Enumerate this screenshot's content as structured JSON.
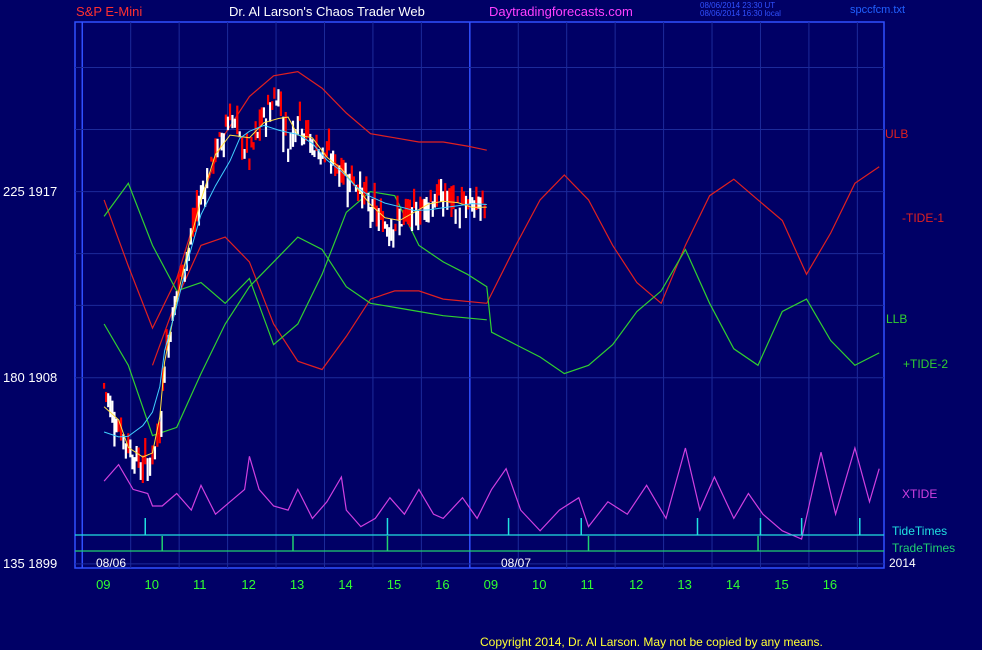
{
  "header": {
    "instrument": "S&P E-Mini",
    "site_title": "Dr. Al Larson's Chaos Trader Web",
    "site_url": "Daytradingforecasts.com",
    "timestamp_ut": "08/06/2014 23:30 UT",
    "timestamp_local": "08/06/2014 16:30 local",
    "chart_file": "spccfcm.txt"
  },
  "copyright": "Copyright 2014, Dr. Al Larson. May not be copied by any means.",
  "colors": {
    "background": "#000066",
    "price_up": "#ffffff",
    "price_down": "#ff0000",
    "ulb": "#e02020",
    "llb": "#30d030",
    "tide1": "#e02020",
    "tide2": "#30d030",
    "xtide": "#d040e0",
    "tidetimes": "#20e0e0",
    "tradetimes": "#20d070"
  },
  "chart_data": {
    "type": "line",
    "y_ticks": [
      {
        "label": "225  1917",
        "value": 1917
      },
      {
        "label": "180  1908",
        "value": 1908
      },
      {
        "label": "135  1899",
        "value": 1899
      }
    ],
    "x_ticks": [
      "09",
      "10",
      "11",
      "12",
      "13",
      "14",
      "15",
      "16",
      "09",
      "10",
      "11",
      "12",
      "13",
      "14",
      "15",
      "16"
    ],
    "date_labels": [
      "08/06",
      "08/07"
    ],
    "year_label": "2014",
    "right_labels": [
      {
        "key": "ulb",
        "text": "ULB"
      },
      {
        "key": "tide1",
        "text": "-TIDE-1"
      },
      {
        "key": "llb",
        "text": "LLB"
      },
      {
        "key": "tide2",
        "text": "+TIDE-2"
      },
      {
        "key": "xtide",
        "text": "XTIDE"
      },
      {
        "key": "tidetimes",
        "text": "TideTimes"
      },
      {
        "key": "tradetimes",
        "text": "TradeTimes"
      }
    ],
    "price_hourly_path": [
      [
        0.0,
        1907.6
      ],
      [
        0.3,
        1905.6
      ],
      [
        0.5,
        1904.7
      ],
      [
        0.8,
        1903.6
      ],
      [
        1.0,
        1904.2
      ],
      [
        1.15,
        1905.3
      ],
      [
        1.25,
        1908.8
      ],
      [
        1.5,
        1912.2
      ],
      [
        1.75,
        1914.2
      ],
      [
        2.0,
        1916.8
      ],
      [
        2.3,
        1918.8
      ],
      [
        2.6,
        1920.8
      ],
      [
        2.8,
        1919.6
      ],
      [
        3.0,
        1918.6
      ],
      [
        3.3,
        1920.6
      ],
      [
        3.6,
        1921.8
      ],
      [
        3.8,
        1919.2
      ],
      [
        4.0,
        1920.8
      ],
      [
        4.3,
        1919.2
      ],
      [
        4.6,
        1918.8
      ],
      [
        4.9,
        1918.0
      ],
      [
        5.2,
        1917.5
      ],
      [
        5.5,
        1916.2
      ],
      [
        5.8,
        1915.4
      ],
      [
        6.1,
        1915.6
      ],
      [
        6.4,
        1915.8
      ],
      [
        6.7,
        1916.6
      ],
      [
        7.0,
        1916.8
      ],
      [
        7.3,
        1916.2
      ],
      [
        7.6,
        1916.4
      ],
      [
        7.9,
        1916.1
      ]
    ],
    "series": [
      {
        "key": "ulb",
        "points": [
          [
            0.0,
            1916.6
          ],
          [
            0.5,
            1913.4
          ],
          [
            1.0,
            1910.4
          ],
          [
            1.5,
            1912.8
          ],
          [
            2.0,
            1916.6
          ],
          [
            2.5,
            1919.8
          ],
          [
            3.0,
            1921.6
          ],
          [
            3.5,
            1922.6
          ],
          [
            4.0,
            1922.8
          ],
          [
            4.5,
            1922.0
          ],
          [
            5.0,
            1920.8
          ],
          [
            5.5,
            1919.8
          ],
          [
            6.0,
            1919.6
          ],
          [
            6.5,
            1919.4
          ],
          [
            7.0,
            1919.4
          ],
          [
            7.5,
            1919.2
          ],
          [
            7.9,
            1919.0
          ]
        ]
      },
      {
        "key": "tide1",
        "points": [
          [
            1.0,
            1908.6
          ],
          [
            1.5,
            1911.8
          ],
          [
            2.0,
            1914.4
          ],
          [
            2.5,
            1914.8
          ],
          [
            3.0,
            1913.6
          ],
          [
            3.5,
            1910.6
          ],
          [
            4.0,
            1908.8
          ],
          [
            4.5,
            1908.4
          ],
          [
            5.0,
            1910.0
          ],
          [
            5.5,
            1911.8
          ],
          [
            6.0,
            1912.2
          ],
          [
            6.5,
            1912.2
          ],
          [
            7.0,
            1911.8
          ],
          [
            7.9,
            1911.6
          ],
          [
            8.5,
            1914.4
          ],
          [
            9.0,
            1916.6
          ],
          [
            9.5,
            1917.8
          ],
          [
            10.0,
            1916.6
          ],
          [
            10.5,
            1914.4
          ],
          [
            11.0,
            1912.6
          ],
          [
            11.5,
            1911.6
          ],
          [
            12.0,
            1914.4
          ],
          [
            12.5,
            1916.8
          ],
          [
            13.0,
            1917.6
          ],
          [
            13.5,
            1916.6
          ],
          [
            14.0,
            1915.6
          ],
          [
            14.5,
            1913.0
          ],
          [
            15.0,
            1915.0
          ],
          [
            15.5,
            1917.4
          ],
          [
            16.0,
            1918.2
          ]
        ]
      },
      {
        "key": "llb",
        "points": [
          [
            0.0,
            1910.6
          ],
          [
            0.5,
            1908.6
          ],
          [
            1.0,
            1905.2
          ],
          [
            1.5,
            1905.6
          ],
          [
            2.0,
            1908.2
          ],
          [
            2.5,
            1910.6
          ],
          [
            3.0,
            1912.4
          ],
          [
            3.5,
            1913.6
          ],
          [
            4.0,
            1914.8
          ],
          [
            4.5,
            1914.2
          ],
          [
            5.0,
            1912.4
          ],
          [
            5.5,
            1911.6
          ],
          [
            6.0,
            1911.4
          ],
          [
            6.5,
            1911.2
          ],
          [
            7.0,
            1911.0
          ],
          [
            7.9,
            1910.8
          ]
        ]
      },
      {
        "key": "tide2",
        "points": [
          [
            0.0,
            1915.8
          ],
          [
            0.5,
            1917.4
          ],
          [
            1.0,
            1914.4
          ],
          [
            1.5,
            1912.2
          ],
          [
            2.0,
            1912.6
          ],
          [
            2.5,
            1911.6
          ],
          [
            3.0,
            1912.8
          ],
          [
            3.5,
            1909.6
          ],
          [
            4.0,
            1910.6
          ],
          [
            4.5,
            1913.0
          ],
          [
            5.0,
            1916.0
          ],
          [
            5.5,
            1917.0
          ],
          [
            6.0,
            1916.8
          ],
          [
            6.5,
            1914.4
          ],
          [
            7.0,
            1913.6
          ],
          [
            7.5,
            1913.0
          ],
          [
            7.9,
            1912.4
          ],
          [
            8.0,
            1910.2
          ],
          [
            8.5,
            1909.6
          ],
          [
            9.0,
            1909.0
          ],
          [
            9.5,
            1908.2
          ],
          [
            10.0,
            1908.6
          ],
          [
            10.5,
            1909.6
          ],
          [
            11.0,
            1911.2
          ],
          [
            11.5,
            1912.2
          ],
          [
            12.0,
            1914.2
          ],
          [
            12.5,
            1911.6
          ],
          [
            13.0,
            1909.4
          ],
          [
            13.5,
            1908.6
          ],
          [
            14.0,
            1911.2
          ],
          [
            14.5,
            1911.8
          ],
          [
            15.0,
            1909.8
          ],
          [
            15.5,
            1908.6
          ],
          [
            16.0,
            1909.2
          ]
        ]
      },
      {
        "key": "xtide",
        "points": [
          [
            0.0,
            1903.0
          ],
          [
            0.3,
            1903.8
          ],
          [
            0.6,
            1902.6
          ],
          [
            0.9,
            1902.4
          ],
          [
            1.0,
            1901.8
          ],
          [
            1.2,
            1901.8
          ],
          [
            1.5,
            1902.4
          ],
          [
            1.8,
            1901.6
          ],
          [
            2.0,
            1902.8
          ],
          [
            2.3,
            1901.4
          ],
          [
            2.6,
            1902.0
          ],
          [
            2.9,
            1902.6
          ],
          [
            3.0,
            1904.2
          ],
          [
            3.2,
            1902.6
          ],
          [
            3.5,
            1901.8
          ],
          [
            3.8,
            1901.6
          ],
          [
            4.0,
            1902.6
          ],
          [
            4.3,
            1901.2
          ],
          [
            4.6,
            1902.0
          ],
          [
            4.9,
            1903.2
          ],
          [
            5.0,
            1901.6
          ],
          [
            5.3,
            1900.8
          ],
          [
            5.6,
            1901.2
          ],
          [
            5.9,
            1902.2
          ],
          [
            6.2,
            1901.4
          ],
          [
            6.5,
            1902.6
          ],
          [
            6.8,
            1901.4
          ],
          [
            7.0,
            1901.2
          ],
          [
            7.4,
            1902.2
          ],
          [
            7.7,
            1901.2
          ],
          [
            8.0,
            1902.6
          ],
          [
            8.3,
            1903.6
          ],
          [
            8.6,
            1901.6
          ],
          [
            9.0,
            1900.6
          ],
          [
            9.4,
            1901.6
          ],
          [
            9.8,
            1902.2
          ],
          [
            10.0,
            1900.8
          ],
          [
            10.4,
            1902.0
          ],
          [
            10.8,
            1901.4
          ],
          [
            11.2,
            1902.8
          ],
          [
            11.6,
            1901.2
          ],
          [
            12.0,
            1904.6
          ],
          [
            12.3,
            1901.6
          ],
          [
            12.6,
            1903.2
          ],
          [
            13.0,
            1901.2
          ],
          [
            13.3,
            1902.4
          ],
          [
            13.6,
            1901.4
          ],
          [
            14.0,
            1900.6
          ],
          [
            14.4,
            1900.2
          ],
          [
            14.8,
            1904.4
          ],
          [
            15.1,
            1901.4
          ],
          [
            15.5,
            1904.6
          ],
          [
            15.8,
            1902.0
          ],
          [
            16.0,
            1903.6
          ]
        ]
      }
    ],
    "tide_times": [
      0.85,
      5.85,
      8.35,
      9.85,
      12.25,
      13.55,
      14.4,
      15.6
    ],
    "trade_times": [
      1.2,
      3.9,
      5.85,
      10.0,
      13.5
    ],
    "xlim": [
      -0.6,
      16.1
    ],
    "ylim": [
      1898.8,
      1925.2
    ]
  }
}
